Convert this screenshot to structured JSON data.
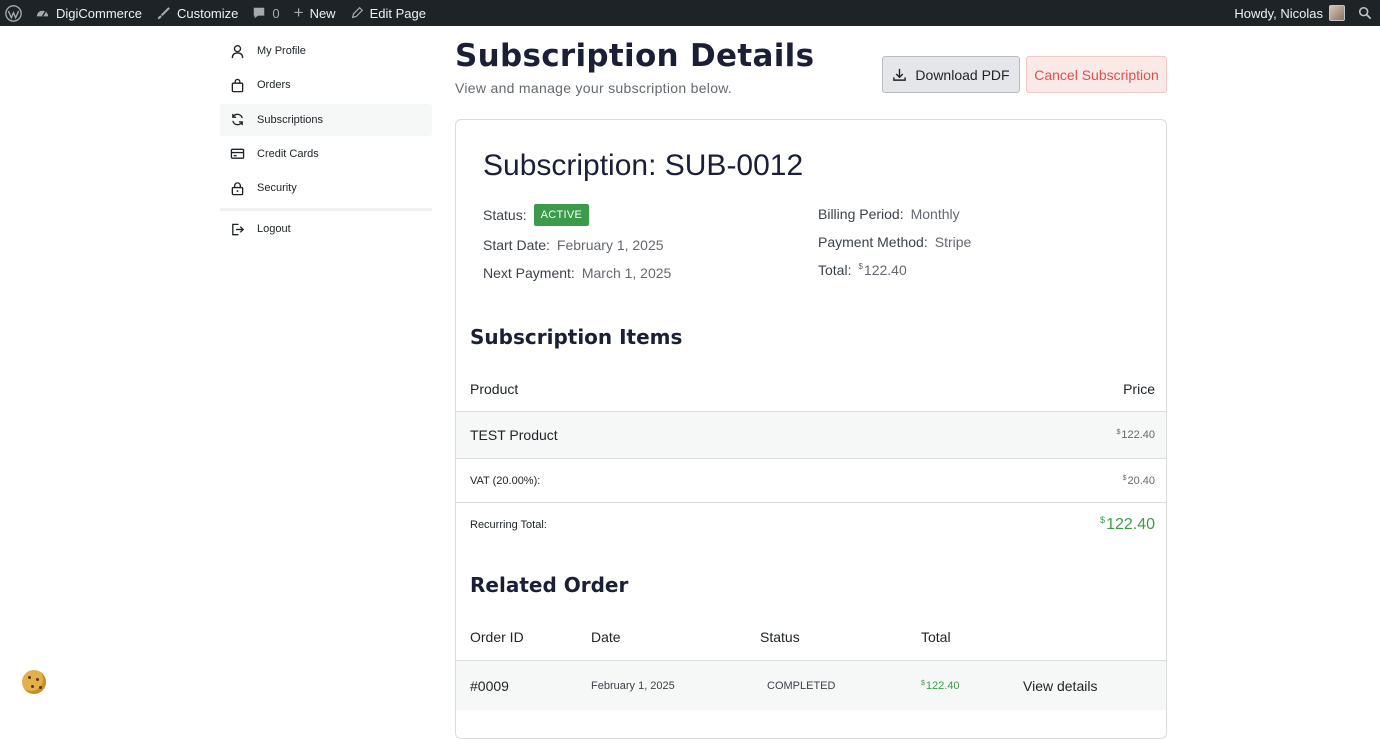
{
  "adminbar": {
    "site_name": "DigiCommerce",
    "customize": "Customize",
    "comments_count": "0",
    "new": "New",
    "edit_page": "Edit Page",
    "howdy": "Howdy, Nicolas"
  },
  "sidebar": {
    "items": [
      {
        "label": "My Profile",
        "icon": "user-icon"
      },
      {
        "label": "Orders",
        "icon": "bag-icon"
      },
      {
        "label": "Subscriptions",
        "icon": "refresh-icon"
      },
      {
        "label": "Credit Cards",
        "icon": "credit-card-icon"
      },
      {
        "label": "Security",
        "icon": "lock-icon"
      }
    ],
    "logout": "Logout",
    "active": "Subscriptions"
  },
  "header": {
    "title": "Subscription Details",
    "subtitle": "View and manage your subscription below.",
    "download_pdf": "Download PDF",
    "cancel_subscription": "Cancel Subscription"
  },
  "subscription": {
    "title": "Subscription: SUB-0012",
    "status_label": "Status:",
    "status_value": "ACTIVE",
    "start_label": "Start Date:",
    "start_value": "February 1, 2025",
    "next_label": "Next Payment:",
    "next_value": "March 1, 2025",
    "billing_label": "Billing Period:",
    "billing_value": "Monthly",
    "method_label": "Payment Method:",
    "method_value": "Stripe",
    "total_label": "Total:",
    "currency": "$",
    "total_value": "122.40"
  },
  "items": {
    "title": "Subscription Items",
    "col_product": "Product",
    "col_price": "Price",
    "product_name": "TEST Product",
    "product_price": "122.40",
    "vat_label": "VAT (20.00%):",
    "vat_value": "20.40",
    "recurring_label": "Recurring Total:",
    "recurring_value": "122.40"
  },
  "related": {
    "title": "Related Order",
    "col_id": "Order ID",
    "col_date": "Date",
    "col_status": "Status",
    "col_total": "Total",
    "order_id": "#0009",
    "order_date": "February 1, 2025",
    "order_status": "COMPLETED",
    "order_total": "122.40",
    "view_details": "View details"
  },
  "colors": {
    "accent_green": "#3c9b4a",
    "cancel_red": "#d9534f",
    "adminbar": "#1d2327"
  }
}
